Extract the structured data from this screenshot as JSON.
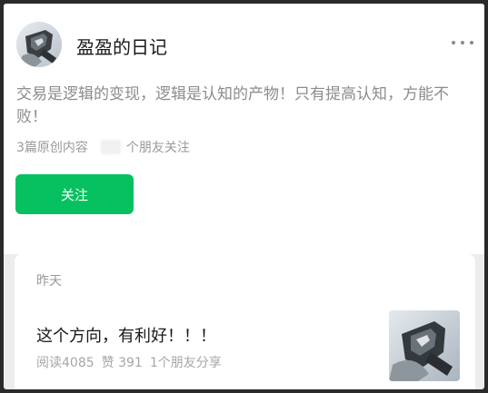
{
  "account": {
    "name": "盈盈的日记",
    "bio": "交易是逻辑的变现，逻辑是认知的产物！只有提高认知，方能不败！",
    "original_count": "3篇原创内容",
    "friends_follow_suffix": "个朋友关注",
    "follow_label": "关注"
  },
  "article": {
    "date": "昨天",
    "title": "这个方向，有利好！！！",
    "reads": "阅读4085",
    "likes": "赞 391",
    "shares": "1个朋友分享"
  },
  "colors": {
    "accent": "#07c160",
    "background": "#ededed"
  },
  "icons": {
    "more": "more-icon"
  }
}
